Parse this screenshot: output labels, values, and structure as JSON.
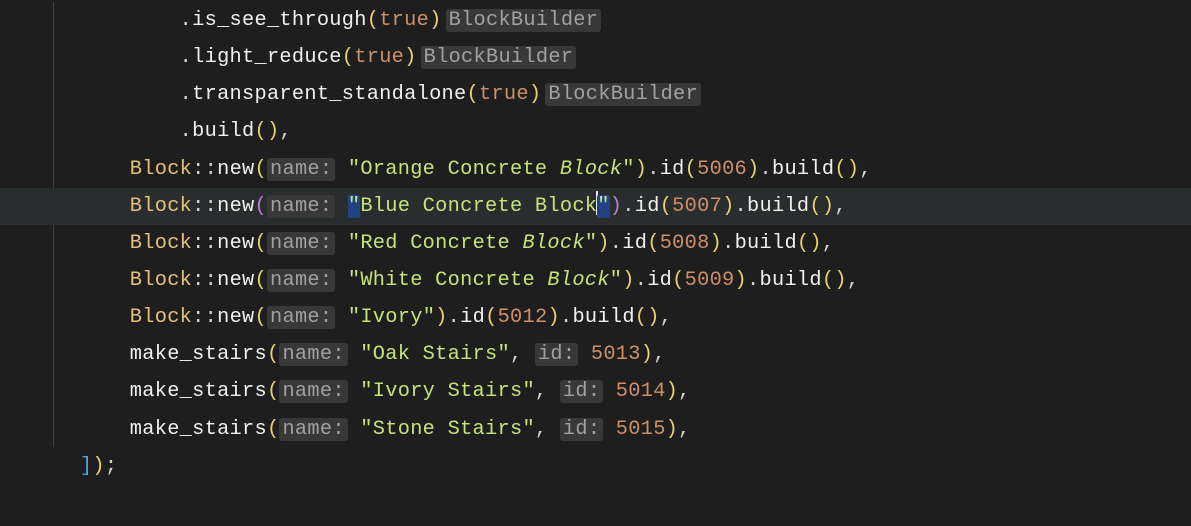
{
  "lines": {
    "l1": {
      "fn": "is_see_through",
      "arg": "true",
      "hint": "BlockBuilder"
    },
    "l2": {
      "fn": "light_reduce",
      "arg": "true",
      "hint": "BlockBuilder"
    },
    "l3": {
      "fn": "transparent_standalone",
      "arg": "true",
      "hint": "BlockBuilder"
    },
    "l4": {
      "fn": "build"
    },
    "l5": {
      "type": "Block",
      "new": "new",
      "param": "name:",
      "str_pre": "Orange Concrete ",
      "str_ital": "Block",
      "id_fn": "id",
      "id_val": "5006",
      "build": "build"
    },
    "l6": {
      "type": "Block",
      "new": "new",
      "param": "name:",
      "str": "Blue Concrete Block",
      "id_fn": "id",
      "id_val": "5007",
      "build": "build"
    },
    "l7": {
      "type": "Block",
      "new": "new",
      "param": "name:",
      "str_pre": "Red Concrete ",
      "str_ital": "Block",
      "id_fn": "id",
      "id_val": "5008",
      "build": "build"
    },
    "l8": {
      "type": "Block",
      "new": "new",
      "param": "name:",
      "str_pre": "White Concrete ",
      "str_ital": "Block",
      "id_fn": "id",
      "id_val": "5009",
      "build": "build"
    },
    "l9": {
      "type": "Block",
      "new": "new",
      "param": "name:",
      "str": "Ivory",
      "id_fn": "id",
      "id_val": "5012",
      "build": "build"
    },
    "l10": {
      "fn": "make_stairs",
      "param1": "name:",
      "str": "Oak Stairs",
      "param2": "id:",
      "id_val": "5013"
    },
    "l11": {
      "fn": "make_stairs",
      "param1": "name:",
      "str": "Ivory Stairs",
      "param2": "id:",
      "id_val": "5014"
    },
    "l12": {
      "fn": "make_stairs",
      "param1": "name:",
      "str": "Stone Stairs",
      "param2": "id:",
      "id_val": "5015"
    },
    "l13": {
      "close": "]);"
    }
  }
}
